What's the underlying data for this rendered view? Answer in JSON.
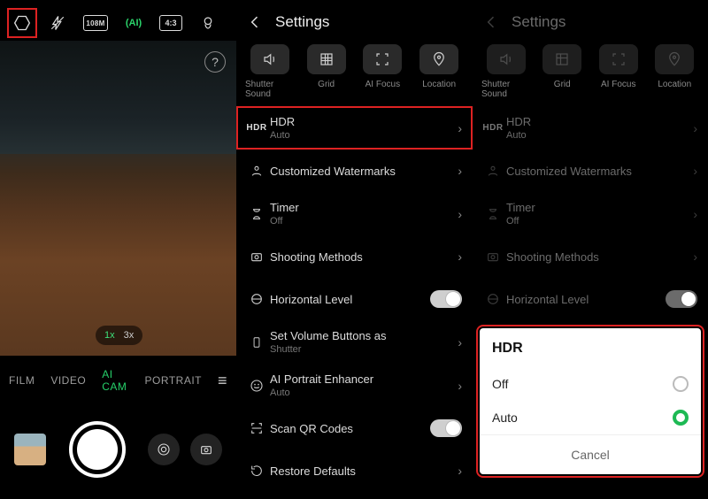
{
  "camera": {
    "topbar_icons": [
      "settings-hex",
      "flash",
      "108m",
      "ai",
      "aspect-4-3",
      "beauty"
    ],
    "badge_108m": "108M",
    "badge_ai": "AI",
    "badge_ratio": "4:3",
    "zoom": {
      "z1": "1x",
      "z2": "3x"
    },
    "modes": {
      "film": "FILM",
      "video": "VIDEO",
      "aicam": "AI CAM",
      "portrait": "PORTRAIT"
    }
  },
  "settings": {
    "title": "Settings",
    "segments": {
      "shutter": "Shutter Sound",
      "grid": "Grid",
      "aifocus": "AI Focus",
      "location": "Location"
    },
    "rows": {
      "hdr": {
        "label": "HDR",
        "sub": "Auto"
      },
      "watermark": {
        "label": "Customized Watermarks"
      },
      "timer": {
        "label": "Timer",
        "sub": "Off"
      },
      "methods": {
        "label": "Shooting Methods"
      },
      "level": {
        "label": "Horizontal Level"
      },
      "volume": {
        "label": "Set Volume Buttons as",
        "sub": "Shutter"
      },
      "aiportrait": {
        "label": "AI Portrait Enhancer",
        "sub": "Auto"
      },
      "qr": {
        "label": "Scan QR Codes"
      },
      "restore": {
        "label": "Restore Defaults"
      }
    }
  },
  "hdr_sheet": {
    "title": "HDR",
    "off": "Off",
    "auto": "Auto",
    "cancel": "Cancel"
  }
}
